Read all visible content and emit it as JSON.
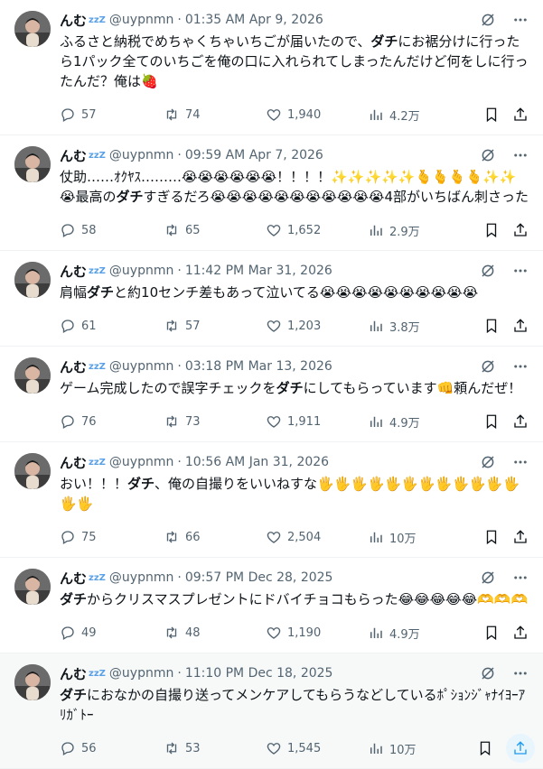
{
  "tweets": [
    {
      "name": "んむ",
      "zzz": "zzZ",
      "handle": "@uypnmn",
      "time": "01:35 AM Apr 9, 2026",
      "text_parts": [
        {
          "t": "ふるさと納税でめちゃくちゃいちごが届いたので、",
          "b": false
        },
        {
          "t": "ダチ",
          "b": true
        },
        {
          "t": "にお裾分けに行ったら1パック全てのいちごを俺の口に入れられてしまったんだけど何をしに行ったんだ？俺は🍓",
          "b": false
        }
      ],
      "replies": "57",
      "retweets": "74",
      "likes": "1,940",
      "views": "4.2万"
    },
    {
      "name": "んむ",
      "zzz": "zzZ",
      "handle": "@uypnmn",
      "time": "09:59 AM Apr 7, 2026",
      "text_parts": [
        {
          "t": "仗助……ｵｸﾔｽ………😭😭😭😭😭😭！！！！✨✨✨✨✨🫰🫰🫰🫰✨✨😭最高の",
          "b": false
        },
        {
          "t": "ダチ",
          "b": true
        },
        {
          "t": "すぎるだろ😭😭😭😭😭😭😭😭😭😭😭4部がいちばん刺さった",
          "b": false
        }
      ],
      "replies": "58",
      "retweets": "65",
      "likes": "1,652",
      "views": "2.9万"
    },
    {
      "name": "んむ",
      "zzz": "zzZ",
      "handle": "@uypnmn",
      "time": "11:42 PM Mar 31, 2026",
      "text_parts": [
        {
          "t": "肩幅",
          "b": false
        },
        {
          "t": "ダチ",
          "b": true
        },
        {
          "t": "と約10センチ差もあって泣いてる😭😭😭😭😭😭😭😭😭😭",
          "b": false
        }
      ],
      "replies": "61",
      "retweets": "57",
      "likes": "1,203",
      "views": "3.8万"
    },
    {
      "name": "んむ",
      "zzz": "zzZ",
      "handle": "@uypnmn",
      "time": "03:18 PM Mar 13, 2026",
      "text_parts": [
        {
          "t": "ゲーム完成したので誤字チェックを",
          "b": false
        },
        {
          "t": "ダチ",
          "b": true
        },
        {
          "t": "にしてもらっています👊頼んだぜ！",
          "b": false
        }
      ],
      "replies": "76",
      "retweets": "73",
      "likes": "1,911",
      "views": "4.9万"
    },
    {
      "name": "んむ",
      "zzz": "zzZ",
      "handle": "@uypnmn",
      "time": "10:56 AM Jan 31, 2026",
      "text_parts": [
        {
          "t": "おい！！！",
          "b": false
        },
        {
          "t": "ダチ",
          "b": true
        },
        {
          "t": "、俺の自撮りをいいねすな🖐🖐🖐🖐🖐🖐🖐🖐🖐🖐🖐🖐🖐🖐",
          "b": false
        }
      ],
      "replies": "75",
      "retweets": "66",
      "likes": "2,504",
      "views": "10万"
    },
    {
      "name": "んむ",
      "zzz": "zzZ",
      "handle": "@uypnmn",
      "time": "09:57 PM Dec 28, 2025",
      "text_parts": [
        {
          "t": "ダチ",
          "b": true
        },
        {
          "t": "からクリスマスプレゼントにドバイチョコもらった😂😂😂😂😂🫶🫶🫶",
          "b": false
        }
      ],
      "replies": "49",
      "retweets": "48",
      "likes": "1,190",
      "views": "4.9万"
    },
    {
      "name": "んむ",
      "zzz": "zzZ",
      "handle": "@uypnmn",
      "time": "11:10 PM Dec 18, 2025",
      "text_parts": [
        {
          "t": "ダチ",
          "b": true
        },
        {
          "t": "におなかの自撮り送ってメンケアしてもらうなどしているﾎﾟｼｮﾝｼﾞｬﾅｲﾖｰｱﾘｶﾞﾄｰ",
          "b": false
        }
      ],
      "replies": "56",
      "retweets": "53",
      "likes": "1,545",
      "views": "10万"
    }
  ],
  "icons": {
    "avatar": "avatar-photo",
    "grok": "slashed-circle-icon",
    "more": "more-dots-icon",
    "reply": "reply-icon",
    "retweet": "retweet-icon",
    "like": "heart-icon",
    "views": "views-icon",
    "bookmark": "bookmark-icon",
    "share": "share-icon"
  },
  "colors": {
    "text": "#0f1419",
    "muted": "#536471",
    "accent": "#1d9bf0",
    "zzz": "#5aa0e6",
    "hover_bg": "#f7f9f9"
  }
}
